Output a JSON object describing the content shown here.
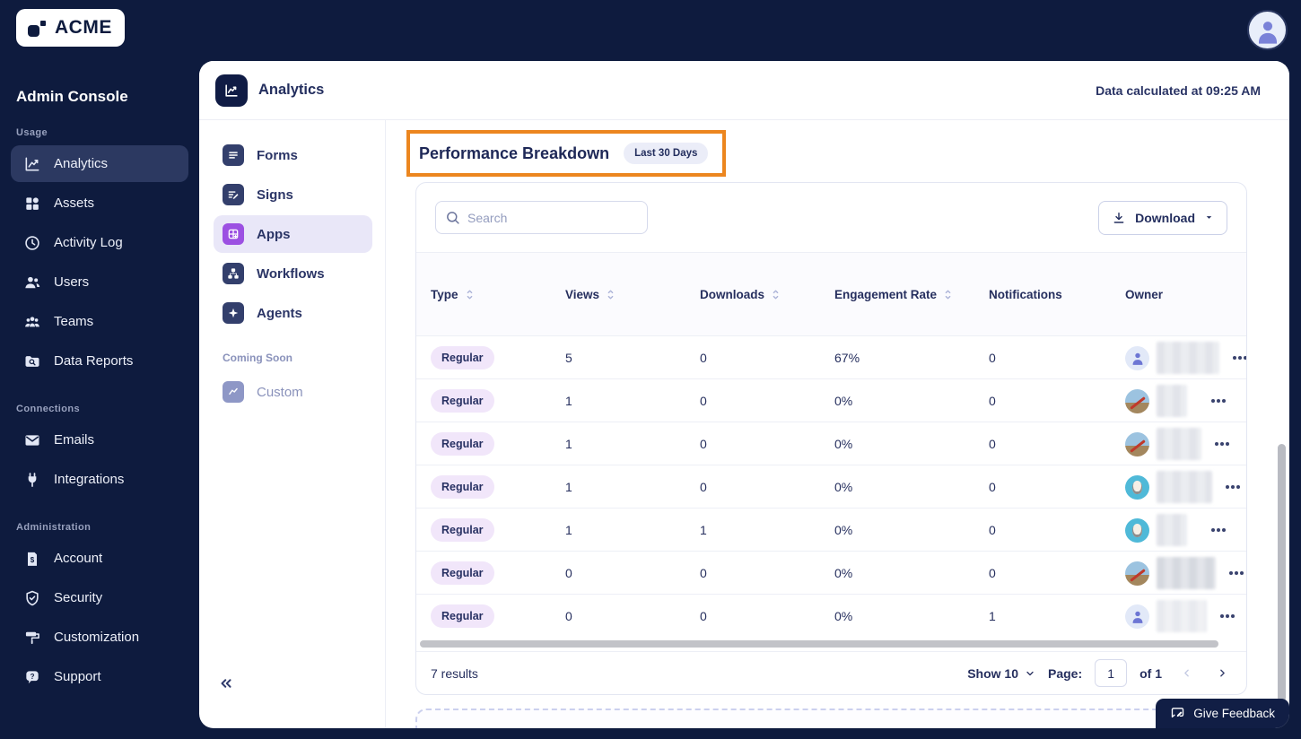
{
  "topbar": {
    "logo_text": "ACME"
  },
  "sidebar": {
    "title": "Admin Console",
    "sections": [
      {
        "label": "Usage",
        "items": [
          {
            "label": "Analytics",
            "icon": "analytics-icon",
            "active": true
          },
          {
            "label": "Assets",
            "icon": "assets-icon"
          },
          {
            "label": "Activity Log",
            "icon": "activity-log-icon"
          },
          {
            "label": "Users",
            "icon": "users-icon"
          },
          {
            "label": "Teams",
            "icon": "teams-icon"
          },
          {
            "label": "Data Reports",
            "icon": "data-reports-icon"
          }
        ]
      },
      {
        "label": "Connections",
        "items": [
          {
            "label": "Emails",
            "icon": "email-icon"
          },
          {
            "label": "Integrations",
            "icon": "plug-icon"
          }
        ]
      },
      {
        "label": "Administration",
        "items": [
          {
            "label": "Account",
            "icon": "billing-doc-icon"
          },
          {
            "label": "Security",
            "icon": "shield-icon"
          },
          {
            "label": "Customization",
            "icon": "paint-roller-icon"
          },
          {
            "label": "Support",
            "icon": "support-chat-icon"
          }
        ]
      }
    ]
  },
  "header": {
    "title": "Analytics",
    "status": "Data calculated at 09:25 AM"
  },
  "subnav": {
    "items": [
      {
        "label": "Forms",
        "icon": "forms-icon"
      },
      {
        "label": "Signs",
        "icon": "signs-icon"
      },
      {
        "label": "Apps",
        "icon": "apps-icon",
        "active": true
      },
      {
        "label": "Workflows",
        "icon": "workflows-icon"
      },
      {
        "label": "Agents",
        "icon": "agents-icon"
      }
    ],
    "coming_soon_label": "Coming Soon",
    "coming_soon_items": [
      {
        "label": "Custom",
        "icon": "custom-chart-icon"
      }
    ]
  },
  "main": {
    "section_title": "Performance Breakdown",
    "period_badge": "Last 30 Days",
    "search_placeholder": "Search",
    "download_label": "Download",
    "table": {
      "columns": [
        {
          "label": "Type",
          "sortable": true
        },
        {
          "label": "Views",
          "sortable": true
        },
        {
          "label": "Downloads",
          "sortable": true
        },
        {
          "label": "Engagement Rate",
          "sortable": true
        },
        {
          "label": "Notifications",
          "sortable": false
        },
        {
          "label": "Owner",
          "sortable": false
        }
      ],
      "rows": [
        {
          "type": "Regular",
          "views": "5",
          "downloads": "0",
          "engagement": "67%",
          "notifications": "0",
          "avatar": "person"
        },
        {
          "type": "Regular",
          "views": "1",
          "downloads": "0",
          "engagement": "0%",
          "notifications": "0",
          "avatar": "photo"
        },
        {
          "type": "Regular",
          "views": "1",
          "downloads": "0",
          "engagement": "0%",
          "notifications": "0",
          "avatar": "photo"
        },
        {
          "type": "Regular",
          "views": "1",
          "downloads": "0",
          "engagement": "0%",
          "notifications": "0",
          "avatar": "cartoon"
        },
        {
          "type": "Regular",
          "views": "1",
          "downloads": "1",
          "engagement": "0%",
          "notifications": "0",
          "avatar": "cartoon"
        },
        {
          "type": "Regular",
          "views": "0",
          "downloads": "0",
          "engagement": "0%",
          "notifications": "0",
          "avatar": "photo"
        },
        {
          "type": "Regular",
          "views": "0",
          "downloads": "0",
          "engagement": "0%",
          "notifications": "1",
          "avatar": "person"
        }
      ]
    },
    "footer": {
      "results": "7 results",
      "show_label": "Show 10",
      "page_label": "Page:",
      "page_value": "1",
      "of_label": "of 1"
    }
  },
  "feedback": {
    "label": "Give Feedback"
  },
  "colors": {
    "brand_navy": "#0E1B3E",
    "accent_purple": "#9C50E2",
    "highlight_orange": "#EC861F",
    "badge_lavender": "#F1E6FA"
  }
}
